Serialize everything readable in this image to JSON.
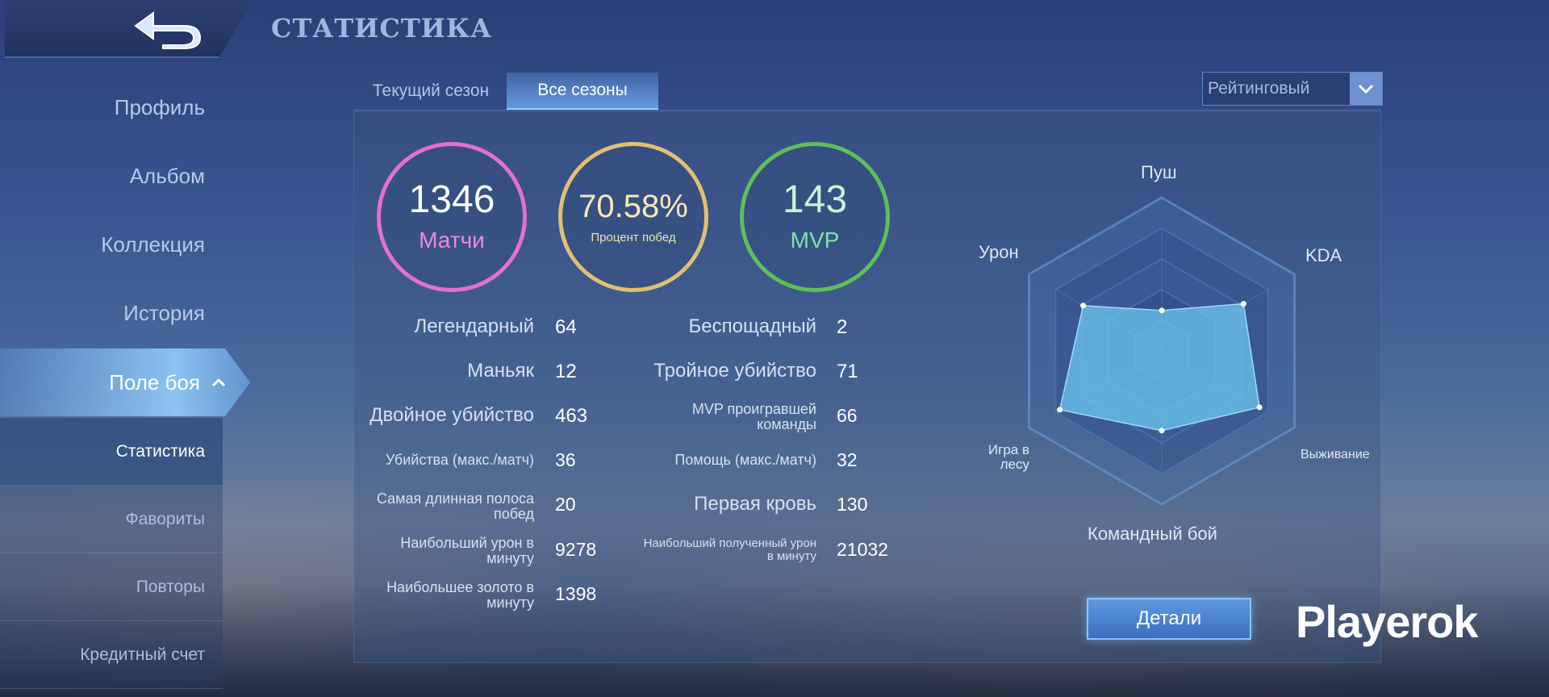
{
  "header": {
    "title": "СТАТИСТИКА"
  },
  "sidebar": {
    "items": [
      "Профиль",
      "Альбом",
      "Коллекция",
      "История"
    ],
    "active": "Поле боя",
    "subitems": [
      "Статистика",
      "Фавориты",
      "Повторы",
      "Кредитный счет"
    ]
  },
  "tabs": {
    "current_season": "Текущий сезон",
    "all_seasons": "Все сезоны"
  },
  "dropdown": {
    "value": "Рейтинговый"
  },
  "summary": {
    "matches": {
      "value": "1346",
      "label": "Матчи",
      "color": "#e36fd6"
    },
    "winrate": {
      "value": "70.58%",
      "label": "Процент побед",
      "color": "#e8c46a"
    },
    "mvp": {
      "value": "143",
      "label": "MVP",
      "color": "#6fd26a"
    }
  },
  "stats_left": [
    {
      "label": "Легендарный",
      "value": "64"
    },
    {
      "label": "Маньяк",
      "value": "12"
    },
    {
      "label": "Двойное убийство",
      "value": "463"
    },
    {
      "label": "Убийства (макс./матч)",
      "value": "36"
    },
    {
      "label": "Самая длинная полоса побед",
      "value": "20"
    },
    {
      "label": "Наибольший урон в минуту",
      "value": "9278"
    },
    {
      "label": "Наибольшее золото в минуту",
      "value": "1398"
    }
  ],
  "stats_right": [
    {
      "label": "Беспощадный",
      "value": "2"
    },
    {
      "label": "Тройное убийство",
      "value": "71"
    },
    {
      "label": "MVP проигравшей команды",
      "value": "66"
    },
    {
      "label": "Помощь (макс./матч)",
      "value": "32"
    },
    {
      "label": "Первая кровь",
      "value": "130"
    },
    {
      "label": "Наибольший полученный урон в минуту",
      "value": "21032"
    }
  ],
  "radar": {
    "labels": {
      "push": "Пуш",
      "kda": "KDA",
      "survival": "Выживание",
      "teamfight": "Командный бой",
      "jungle": "Игра в лесу",
      "damage": "Урон"
    }
  },
  "chart_data": {
    "type": "radar",
    "axes": [
      "Пуш",
      "KDA",
      "Выживание",
      "Командный бой",
      "Игра в лесу",
      "Урон"
    ],
    "values": [
      0.33,
      0.77,
      0.92,
      0.65,
      0.96,
      0.74
    ],
    "range": [
      0,
      1
    ]
  },
  "buttons": {
    "details": "Детали"
  },
  "watermark": "Playerok"
}
